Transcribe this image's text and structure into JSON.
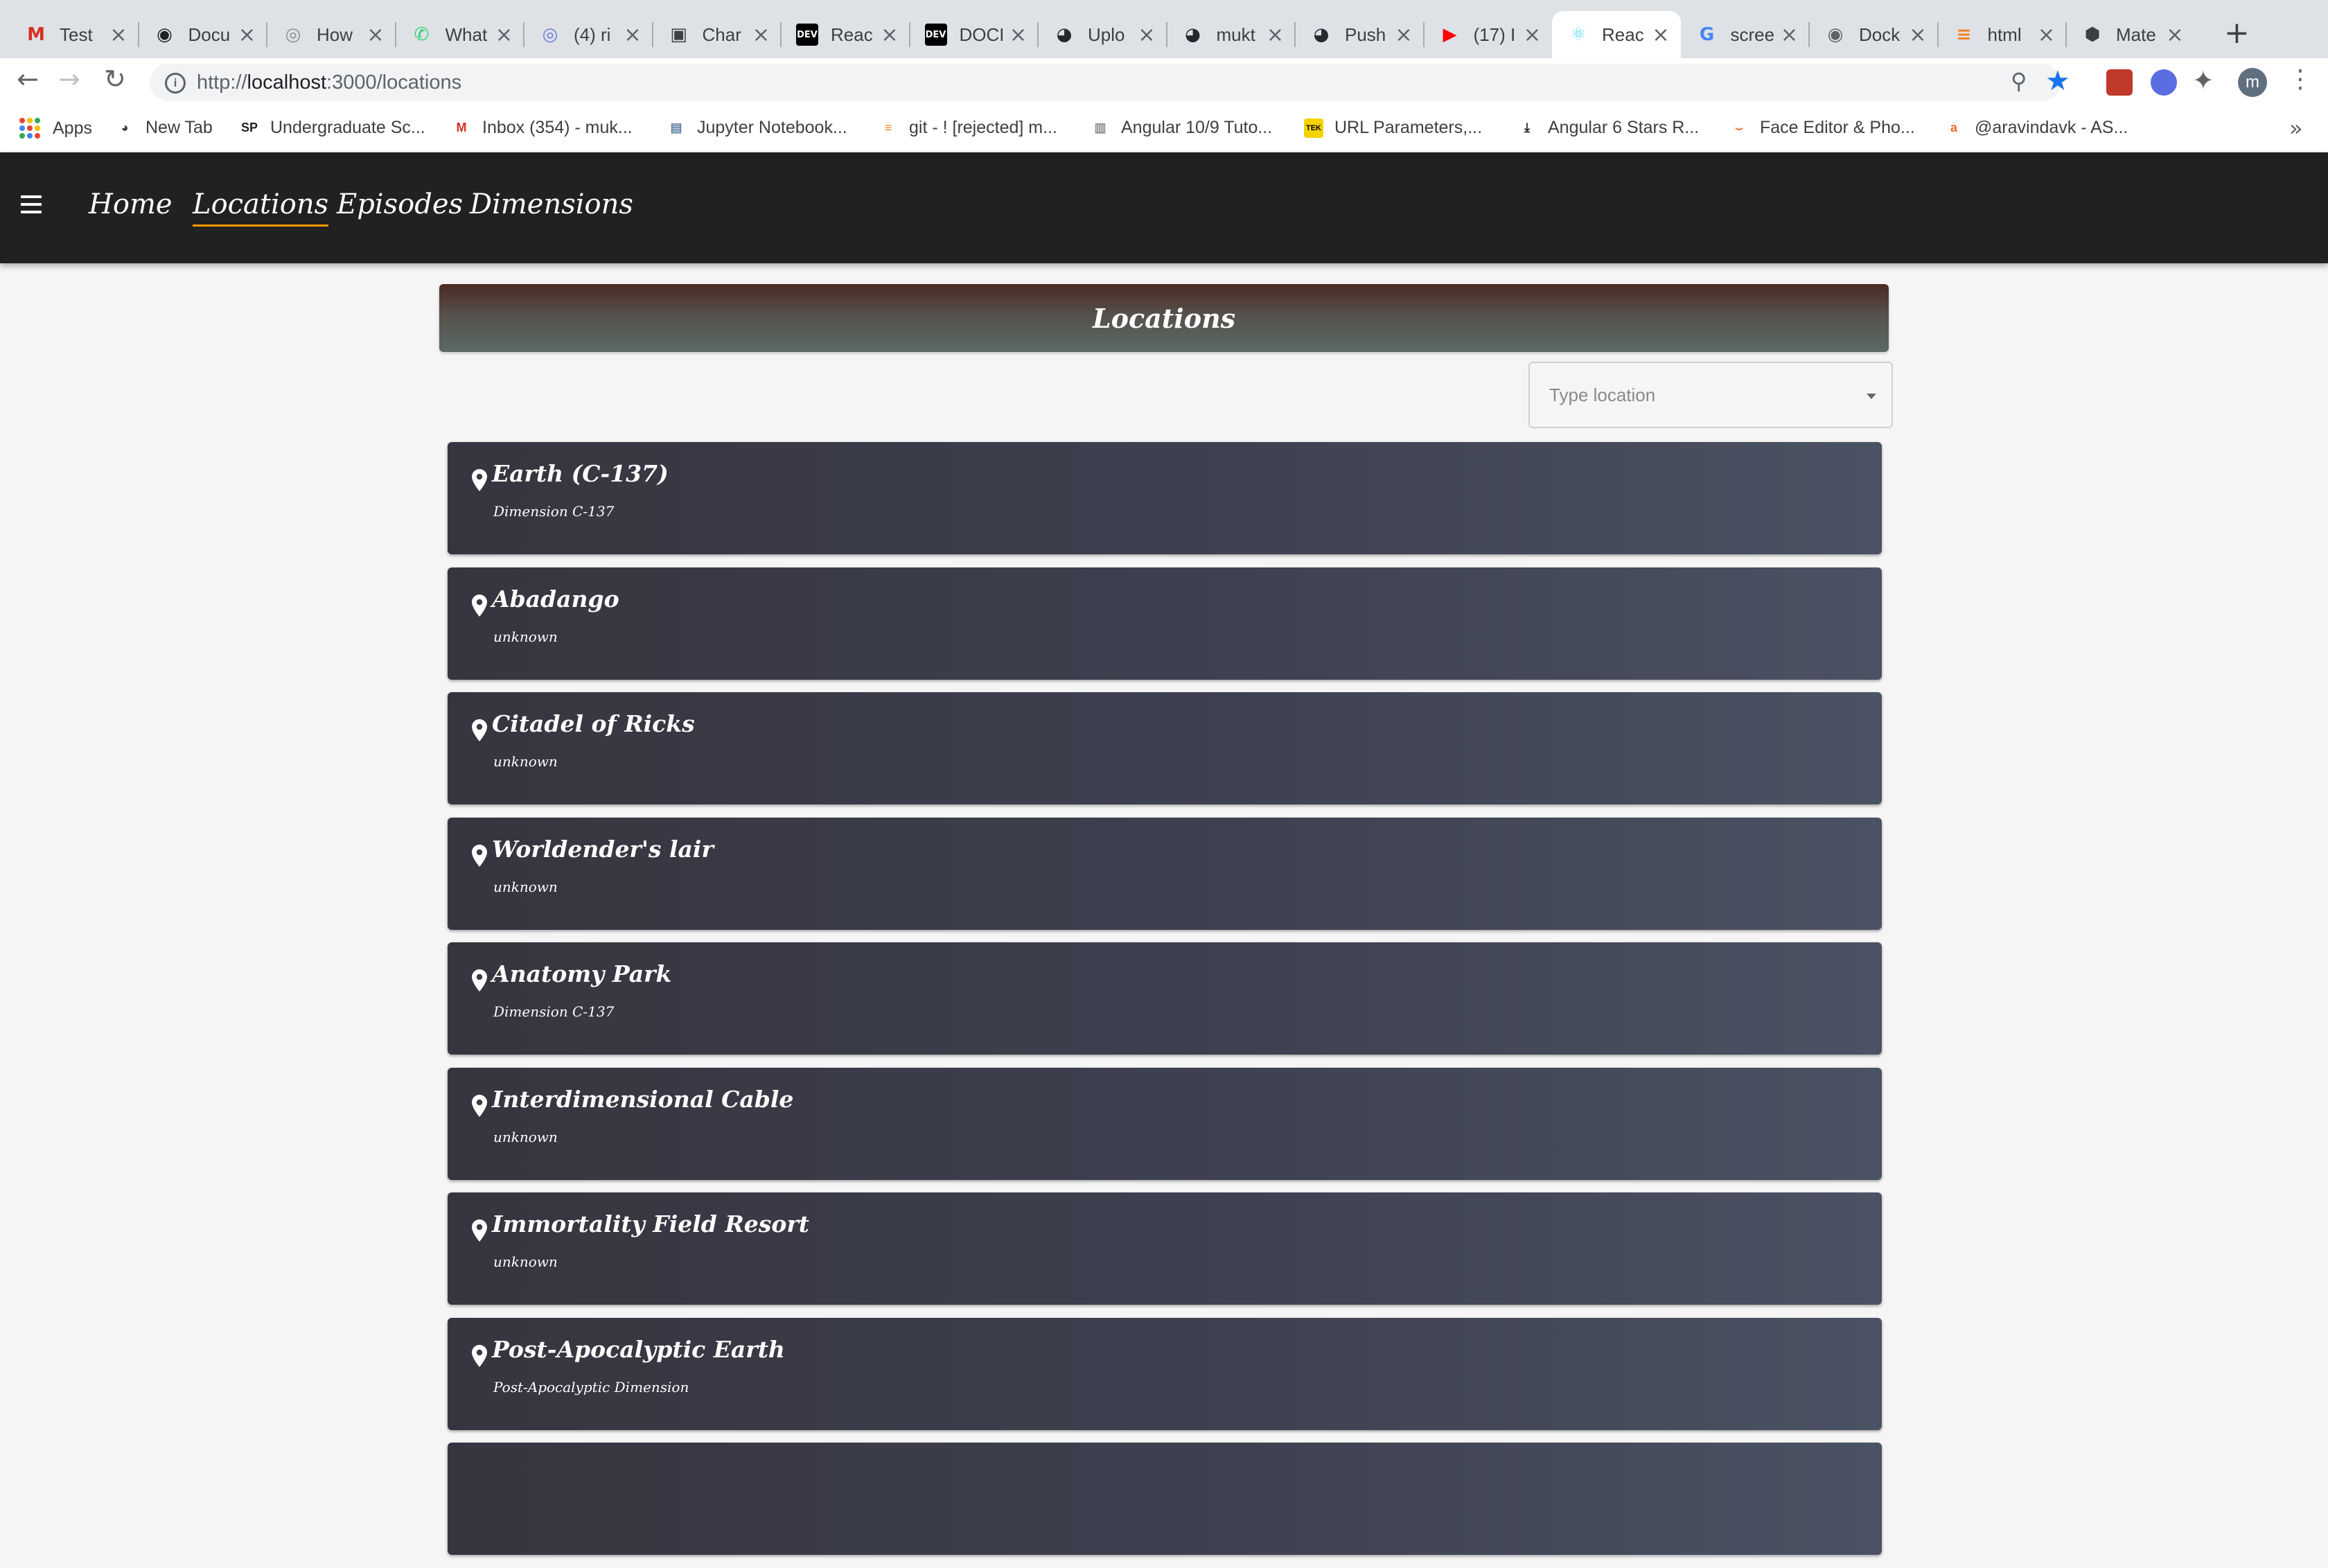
{
  "browser": {
    "tabs": [
      {
        "title": "Test",
        "icon": "gmail-icon",
        "color": "#d93025",
        "glyph": "M"
      },
      {
        "title": "Docu",
        "icon": "globe-icon",
        "color": "#202124",
        "glyph": "◉"
      },
      {
        "title": "How",
        "icon": "site-icon",
        "color": "#8a8d91",
        "glyph": "◎"
      },
      {
        "title": "What",
        "icon": "whatsapp-icon",
        "color": "#25d366",
        "glyph": "✆"
      },
      {
        "title": "(4) ri",
        "icon": "site-icon",
        "color": "#6e7bd9",
        "glyph": "◎"
      },
      {
        "title": "Char",
        "icon": "cube-icon",
        "color": "#3c4043",
        "glyph": "▣"
      },
      {
        "title": "Reac",
        "icon": "dev-icon",
        "color": "#000000",
        "glyph": "DEV"
      },
      {
        "title": "DOCI",
        "icon": "dev-icon",
        "color": "#000000",
        "glyph": "DEV"
      },
      {
        "title": "Uplo",
        "icon": "github-icon",
        "color": "#24292e",
        "glyph": "◕"
      },
      {
        "title": "mukt",
        "icon": "github-icon",
        "color": "#24292e",
        "glyph": "◕"
      },
      {
        "title": "Push",
        "icon": "github-icon",
        "color": "#24292e",
        "glyph": "◕"
      },
      {
        "title": "(17) I",
        "icon": "youtube-icon",
        "color": "#ff0000",
        "glyph": "▶"
      },
      {
        "title": "Reac",
        "icon": "react-icon",
        "color": "#61dafb",
        "glyph": "⚛"
      },
      {
        "title": "scree",
        "icon": "google-icon",
        "color": "#4285f4",
        "glyph": "G"
      },
      {
        "title": "Dock",
        "icon": "site-icon",
        "color": "#5f6368",
        "glyph": "◉"
      },
      {
        "title": "html",
        "icon": "stack-icon",
        "color": "#f48024",
        "glyph": "≡"
      },
      {
        "title": "Mate",
        "icon": "cube-icon",
        "color": "#3c4043",
        "glyph": "⬢"
      }
    ],
    "active_tab_index": 12,
    "url_prefix": "http://",
    "url_host": "localhost",
    "url_rest": ":3000/locations",
    "bookmarks": [
      {
        "label": "Apps",
        "icon": "apps-grid-icon"
      },
      {
        "label": "New Tab",
        "icon": "globe-icon",
        "glyph": "◕",
        "color": "#3c4043"
      },
      {
        "label": "Undergraduate Sc...",
        "icon": "sp-icon",
        "glyph": "SP",
        "color": "#202124"
      },
      {
        "label": "Inbox (354) - muk...",
        "icon": "gmail-icon",
        "glyph": "M",
        "color": "#d93025"
      },
      {
        "label": "Jupyter Notebook...",
        "icon": "notebook-icon",
        "glyph": "▤",
        "color": "#5f7fa7"
      },
      {
        "label": "git - ! [rejected] m...",
        "icon": "stack-icon",
        "glyph": "≡",
        "color": "#f48024"
      },
      {
        "label": "Angular 10/9 Tuto...",
        "icon": "site-icon",
        "glyph": "▥",
        "color": "#8a8d91"
      },
      {
        "label": "URL Parameters,...",
        "icon": "tek-icon",
        "glyph": "TEK",
        "color": "#b59b00"
      },
      {
        "label": "Angular 6 Stars R...",
        "icon": "download-icon",
        "glyph": "⤓",
        "color": "#202124"
      },
      {
        "label": "Face Editor & Pho...",
        "icon": "face-editor-icon",
        "glyph": "⌣",
        "color": "#e8743b"
      },
      {
        "label": "@aravindavk - AS...",
        "icon": "a-icon",
        "glyph": "a",
        "color": "#f06a2a"
      }
    ],
    "profile_initial": "m"
  },
  "app": {
    "nav": [
      {
        "label": "Home",
        "active": false
      },
      {
        "label": "Locations",
        "active": true
      },
      {
        "label": "Episodes",
        "active": false
      },
      {
        "label": "Dimensions",
        "active": false
      }
    ],
    "page_title": "Locations",
    "search_placeholder": "Type location",
    "locations": [
      {
        "name": "Earth (C-137)",
        "dimension": "Dimension C-137"
      },
      {
        "name": "Abadango",
        "dimension": "unknown"
      },
      {
        "name": "Citadel of Ricks",
        "dimension": "unknown"
      },
      {
        "name": "Worldender's lair",
        "dimension": "unknown"
      },
      {
        "name": "Anatomy Park",
        "dimension": "Dimension C-137"
      },
      {
        "name": "Interdimensional Cable",
        "dimension": "unknown"
      },
      {
        "name": "Immortality Field Resort",
        "dimension": "unknown"
      },
      {
        "name": "Post-Apocalyptic Earth",
        "dimension": "Post-Apocalyptic Dimension"
      },
      {
        "name": "",
        "dimension": ""
      }
    ]
  }
}
